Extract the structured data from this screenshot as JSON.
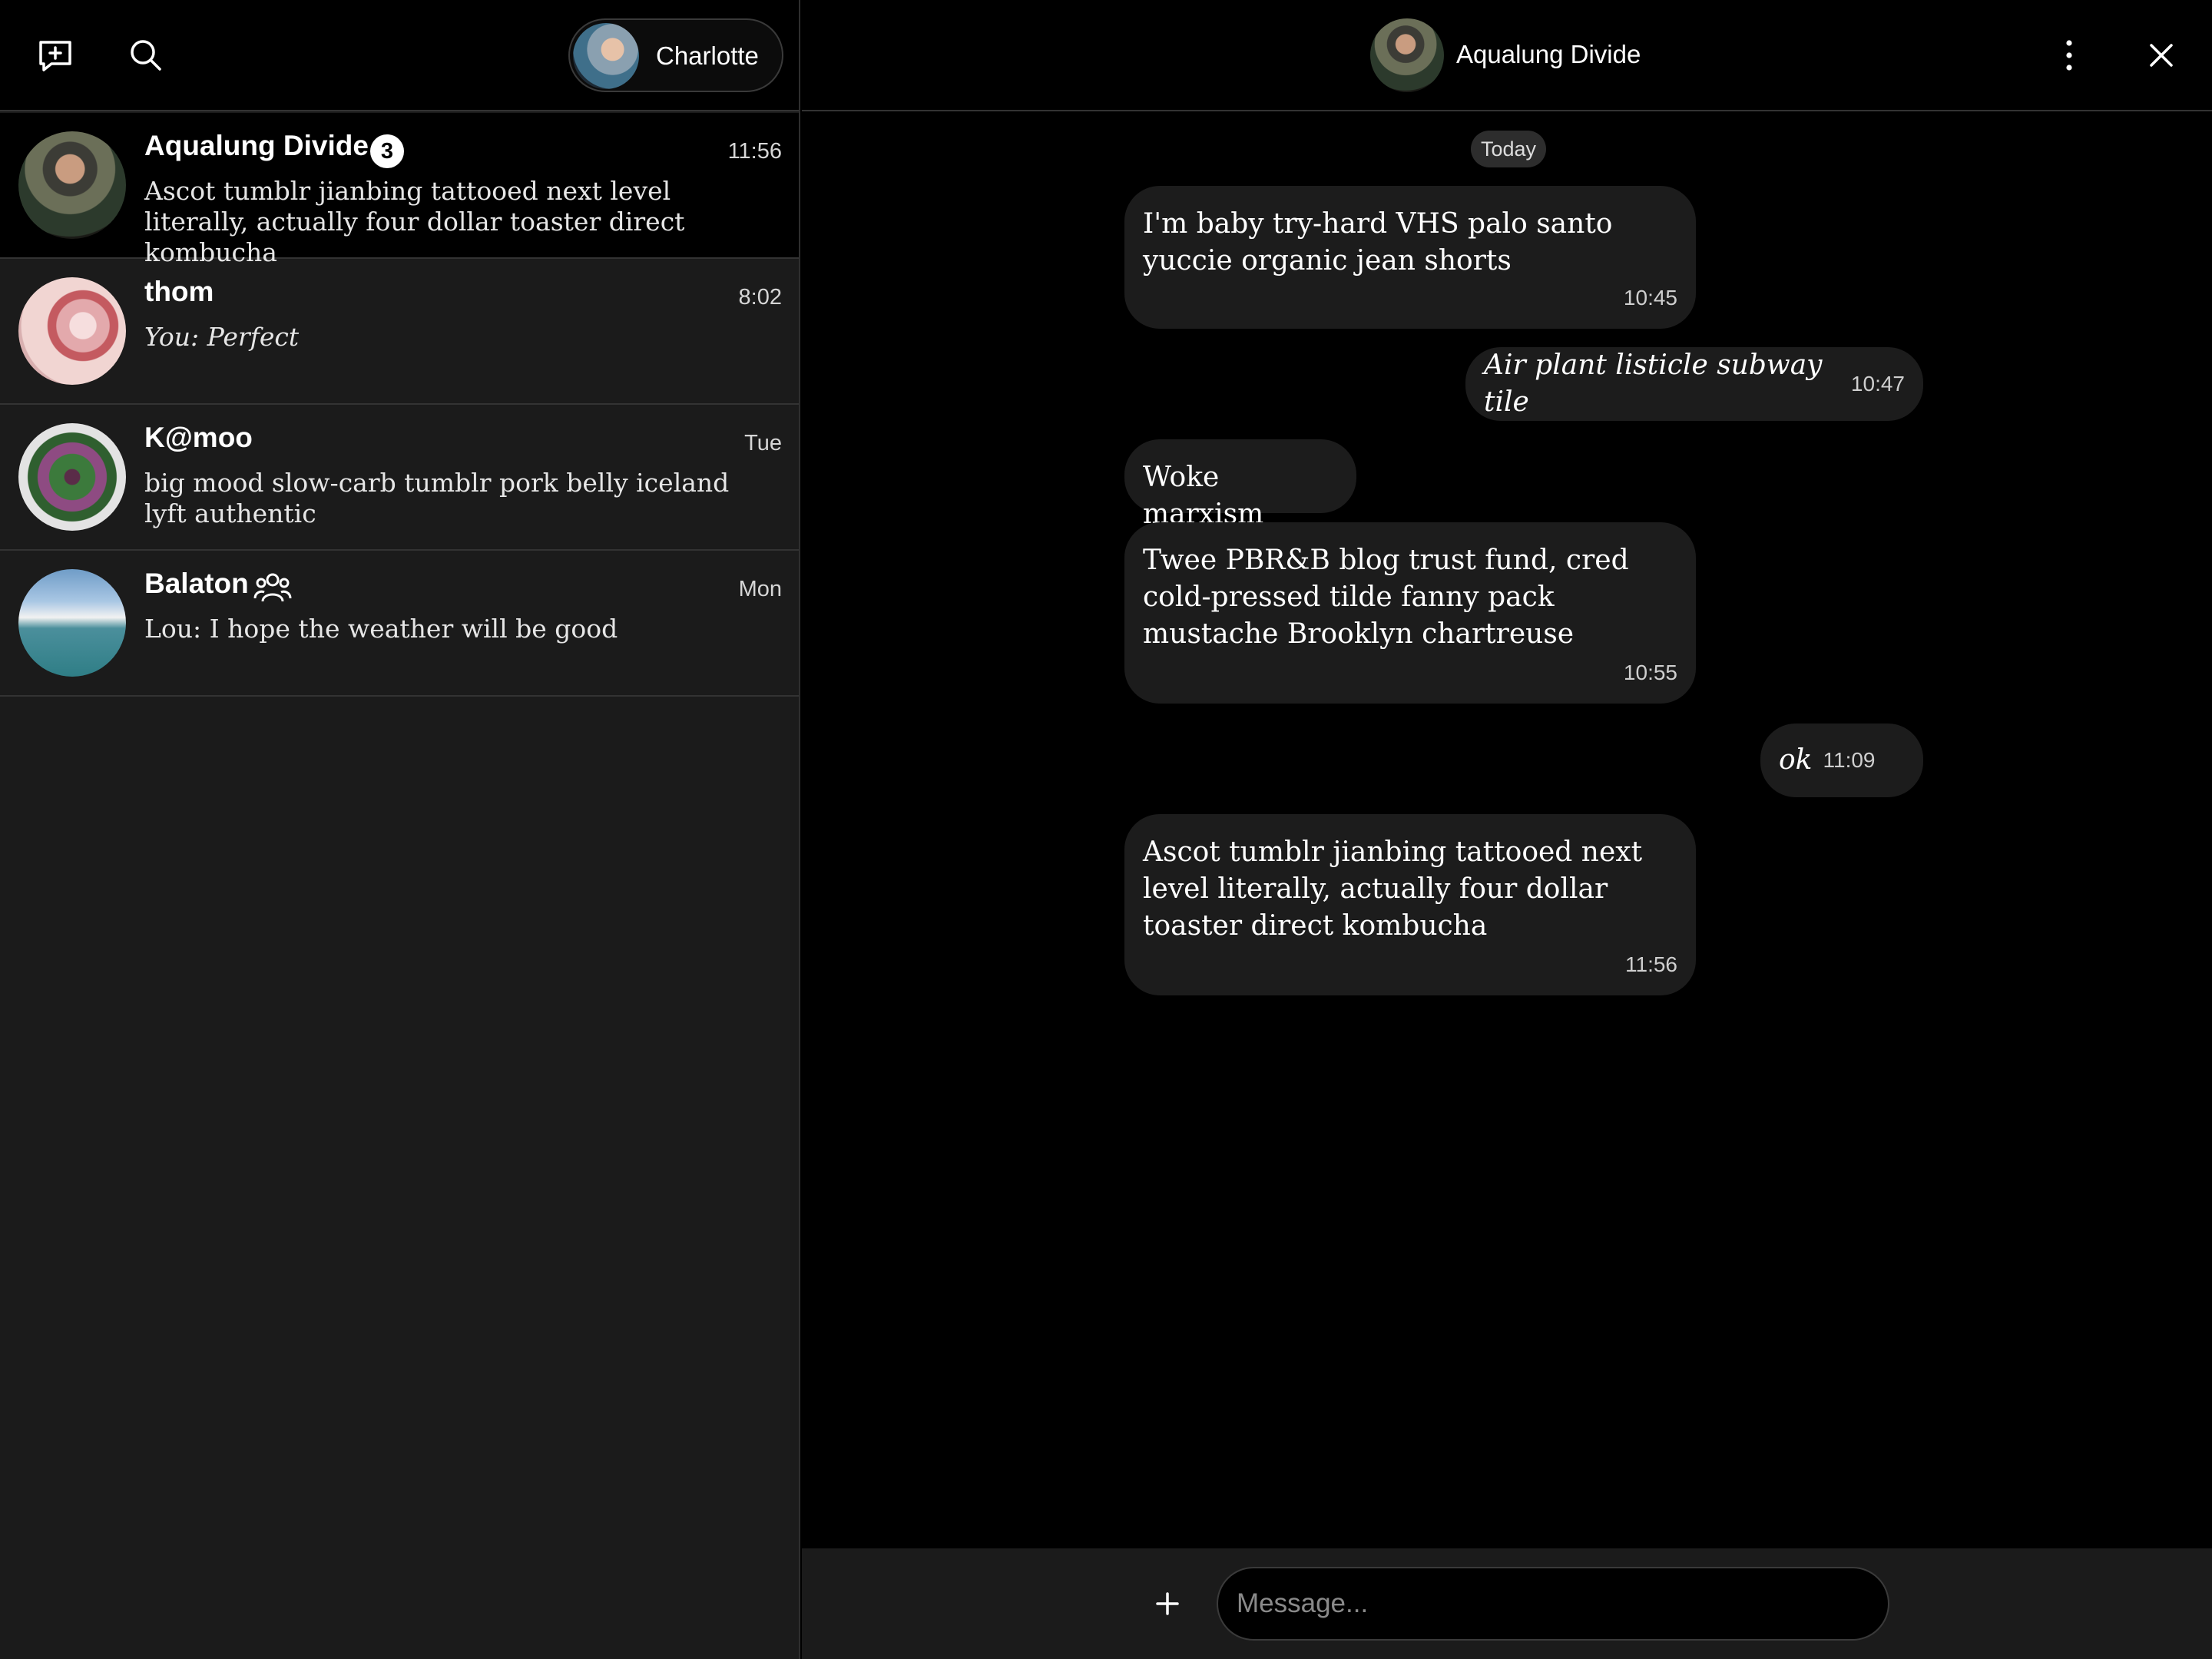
{
  "user": {
    "name": "Charlotte"
  },
  "icons": {
    "compose": "compose-icon",
    "search": "search-icon",
    "more": "more-vertical-icon",
    "close": "close-icon",
    "attach": "plus-icon",
    "group": "group-icon"
  },
  "conversations": [
    {
      "name": "Aqualung Divide",
      "badge": "3",
      "time": "11:56",
      "preview": "Ascot tumblr jianbing tattooed next level literally, actually four dollar toaster direct kombucha"
    },
    {
      "name": "thom",
      "time": "8:02",
      "preview": "You: Perfect"
    },
    {
      "name": "K@moo",
      "time": "Tue",
      "preview": "big mood slow-carb tumblr pork belly iceland lyft authentic"
    },
    {
      "name": "Balaton",
      "time": "Mon",
      "preview": "Lou: I hope the weather will be good"
    }
  ],
  "chat": {
    "title": "Aqualung Divide",
    "date_label": "Today",
    "messages": [
      {
        "direction": "in",
        "text": "I'm baby try-hard VHS palo santo yuccie organic jean shorts",
        "time": "10:45"
      },
      {
        "direction": "out",
        "text": "Air plant listicle subway tile",
        "time": "10:47"
      },
      {
        "direction": "in",
        "text": "Woke marxism",
        "time": ""
      },
      {
        "direction": "in",
        "text": "Twee PBR&B blog trust fund, cred cold-pressed tilde fanny pack mustache Brooklyn chartreuse",
        "time": "10:55"
      },
      {
        "direction": "out",
        "text": "ok",
        "time": "11:09"
      },
      {
        "direction": "in",
        "text": "Ascot tumblr jianbing tattooed next level literally, actually four dollar toaster direct kombucha",
        "time": "11:56"
      }
    ]
  },
  "composer": {
    "placeholder": "Message..."
  }
}
